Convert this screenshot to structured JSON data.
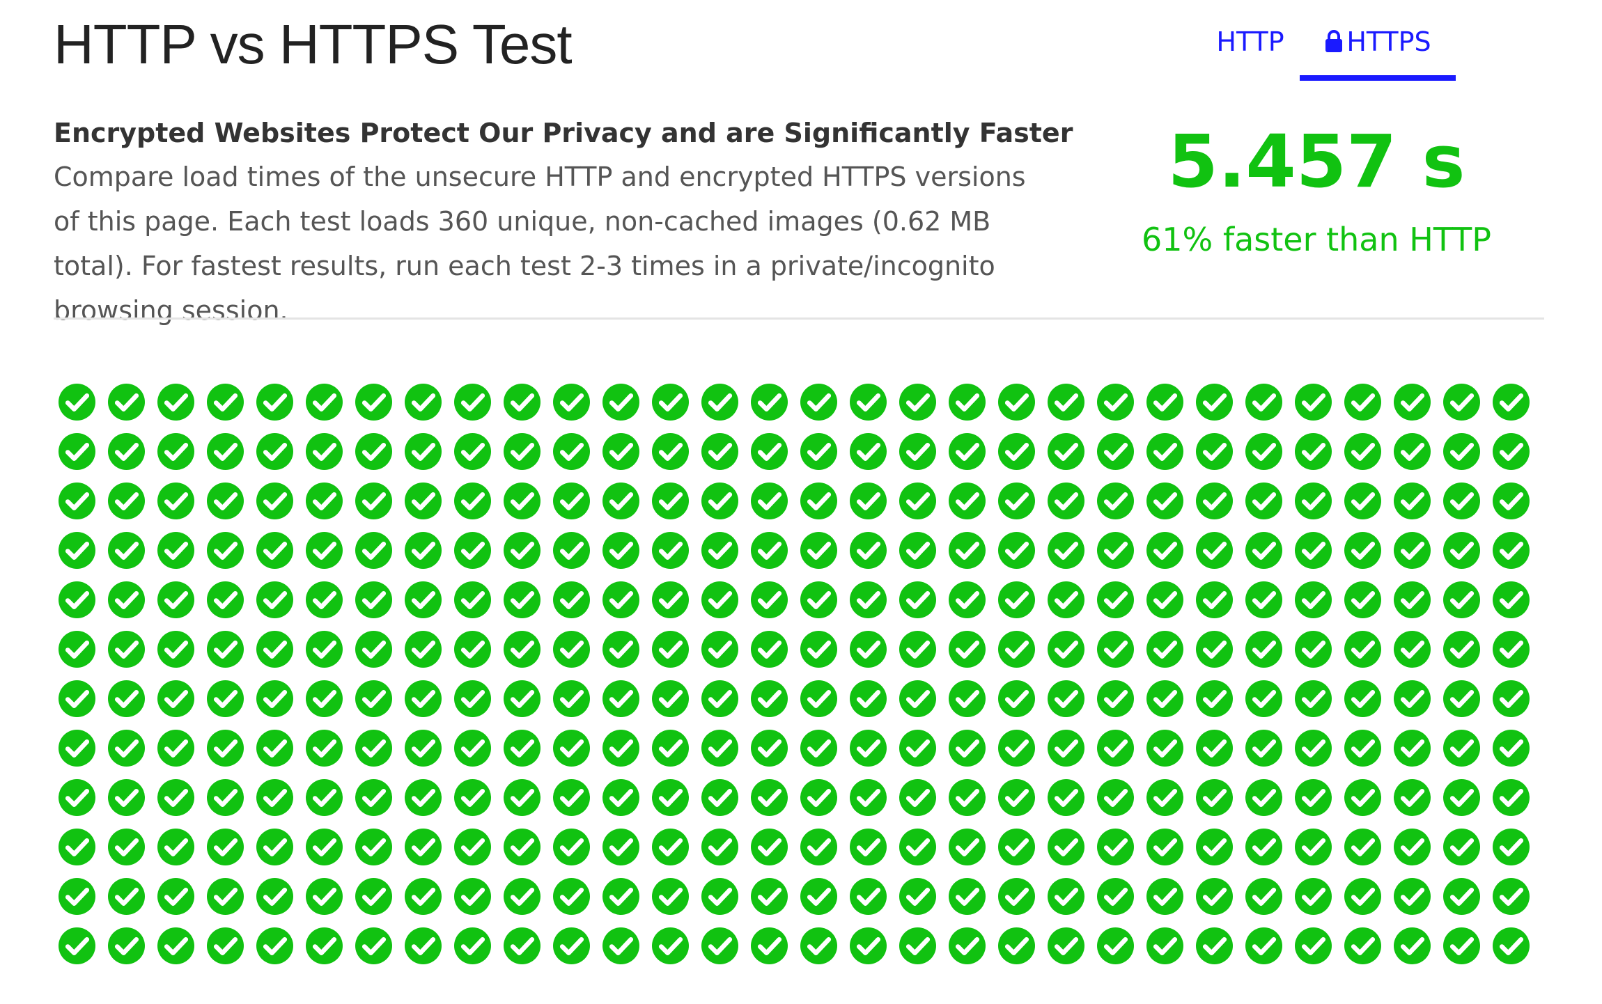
{
  "title": "HTTP vs HTTPS Test",
  "intro": {
    "heading": "Encrypted Websites Protect Our Privacy and are Significantly Faster",
    "text": "Compare load times of the unsecure HTTP and encrypted HTTPS versions of this page. Each test loads 360 unique, non-cached images (0.62 MB total). For fastest results, run each test 2-3 times in a private/incognito browsing session."
  },
  "tabs": [
    {
      "label": "HTTP",
      "active": false
    },
    {
      "label": "HTTPS",
      "active": true,
      "icon": "lock-icon"
    }
  ],
  "result": {
    "time": "5.457 s",
    "comparison": "61% faster than HTTP"
  },
  "grid": {
    "rows": 12,
    "columns": 30,
    "icon": "check-circle-icon",
    "status": "loaded"
  },
  "colors": {
    "success": "#11c211",
    "tab_link": "#1a1aff",
    "divider": "#e4e4e4",
    "title": "#222222"
  }
}
